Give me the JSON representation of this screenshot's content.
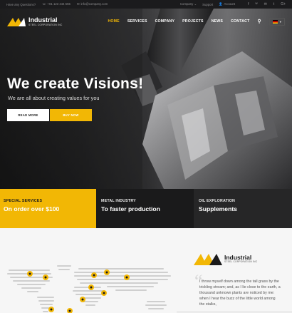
{
  "topbar": {
    "question": "Have any Questions?",
    "phone": "+01 123 444 555",
    "email": "info@company.com",
    "company": "Company",
    "support": "Support",
    "account": "Account",
    "social": [
      "f",
      "ᵂ",
      "✉",
      "t",
      "G+"
    ]
  },
  "brand": {
    "name": "Industrial",
    "tagline": "STEEL CORPORATION INC"
  },
  "nav": {
    "items": [
      "HOME",
      "SERVICES",
      "COMPANY",
      "PROJECTS",
      "NEWS",
      "CONTACT"
    ],
    "active_index": 0
  },
  "hero": {
    "headline": "We create Visions!",
    "subheading": "We are all about creating values for you",
    "button_primary": "READ MORE",
    "button_secondary": "BUY NOW"
  },
  "features": [
    {
      "kicker": "SPECIAL SERVICES",
      "title": "On order over $100"
    },
    {
      "kicker": "METAL INDUSTRY",
      "title": "To faster production"
    },
    {
      "kicker": "OIL EXPLORATION",
      "title": "Supplements"
    }
  ],
  "about": {
    "brand_name": "Industrial",
    "brand_tagline": "STEEL CORPORATION INC",
    "quote": "I throw myself down among the tall grass by the trickling stream; and, as I lie close to the earth, a thousand unknown plants are noticed by me: when I hear the buzz of the little world among the stalks,"
  },
  "colors": {
    "accent": "#f2b705",
    "dark": "#1a1a1b"
  }
}
